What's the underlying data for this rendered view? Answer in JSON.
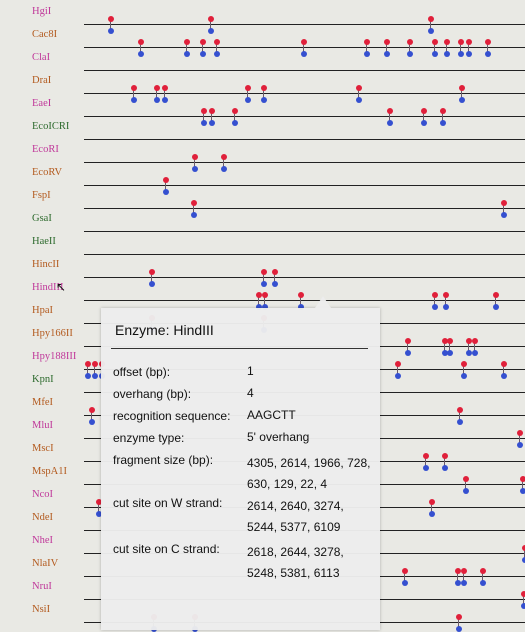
{
  "colors": {
    "red": "#e0203a",
    "blue": "#3550d0",
    "lane": "#222222"
  },
  "cursor_icon": "pointer-arrow-icon",
  "lanes": [
    {
      "name": "HgiI",
      "color": "#c0389a",
      "sites": [
        108,
        208,
        428
      ]
    },
    {
      "name": "Cac8I",
      "color": "#b35a1e",
      "sites": [
        138,
        184,
        200,
        214,
        301,
        364,
        384,
        407,
        432,
        444,
        458,
        466,
        485
      ]
    },
    {
      "name": "ClaI",
      "color": "#c0389a",
      "sites": []
    },
    {
      "name": "DraI",
      "color": "#b35a1e",
      "sites": [
        131,
        154,
        162,
        245,
        261,
        356,
        459
      ]
    },
    {
      "name": "EaeI",
      "color": "#c0389a",
      "sites": [
        201,
        209,
        232,
        387,
        421,
        440
      ]
    },
    {
      "name": "EcoICRI",
      "color": "#2d6a2d",
      "sites": []
    },
    {
      "name": "EcoRI",
      "color": "#c0389a",
      "sites": [
        192,
        221
      ]
    },
    {
      "name": "EcoRV",
      "color": "#b35a1e",
      "sites": [
        163
      ]
    },
    {
      "name": "FspI",
      "color": "#b35a1e",
      "sites": [
        191,
        501
      ]
    },
    {
      "name": "GsaI",
      "color": "#2d6a2d",
      "sites": []
    },
    {
      "name": "HaeII",
      "color": "#2d6a2d",
      "sites": []
    },
    {
      "name": "HincII",
      "color": "#b35a1e",
      "sites": [
        149,
        261,
        272
      ]
    },
    {
      "name": "HindIII",
      "color": "#c0389a",
      "sites": [
        256,
        262,
        298,
        432,
        443,
        493
      ]
    },
    {
      "name": "HpaI",
      "color": "#b35a1e",
      "sites": [
        149,
        261
      ]
    },
    {
      "name": "Hpy166II",
      "color": "#b35a1e",
      "sites": [
        405,
        442,
        447,
        466,
        472
      ]
    },
    {
      "name": "Hpy188III",
      "color": "#c0389a",
      "sites": [
        85,
        92,
        99,
        395,
        461,
        501
      ]
    },
    {
      "name": "KpnI",
      "color": "#2d6a2d",
      "sites": []
    },
    {
      "name": "MfeI",
      "color": "#b35a1e",
      "sites": [
        89,
        457
      ]
    },
    {
      "name": "MluI",
      "color": "#c0389a",
      "sites": [
        517
      ]
    },
    {
      "name": "MscI",
      "color": "#b35a1e",
      "sites": [
        423,
        442
      ]
    },
    {
      "name": "MspA1I",
      "color": "#b35a1e",
      "sites": [
        463,
        520
      ]
    },
    {
      "name": "NcoI",
      "color": "#c0389a",
      "sites": [
        96,
        429
      ]
    },
    {
      "name": "NdeI",
      "color": "#b35a1e",
      "sites": []
    },
    {
      "name": "NheI",
      "color": "#c0389a",
      "sites": [
        522
      ]
    },
    {
      "name": "NlaIV",
      "color": "#b35a1e",
      "sites": [
        402,
        455,
        461,
        480
      ]
    },
    {
      "name": "NruI",
      "color": "#c0389a",
      "sites": [
        521
      ]
    },
    {
      "name": "NsiI",
      "color": "#b35a1e",
      "sites": [
        151,
        192,
        456
      ]
    }
  ],
  "tooltip": {
    "title": "Enzyme: HindIII",
    "rows": [
      {
        "key": "offset (bp):",
        "value": "1"
      },
      {
        "key": "overhang (bp):",
        "value": "4"
      },
      {
        "key": "recognition sequence:",
        "value": "AAGCTT"
      },
      {
        "key": "enzyme type:",
        "value": "5' overhang"
      },
      {
        "key": "fragment size (bp):",
        "value": "4305, 2614, 1966, 728, 630, 129, 22, 4"
      },
      {
        "key": "cut site on W strand:",
        "value": "2614, 2640, 3274, 5244, 5377, 6109"
      },
      {
        "key": "cut site on C strand:",
        "value": "2618, 2644, 3278, 5248, 5381, 6113"
      }
    ]
  }
}
